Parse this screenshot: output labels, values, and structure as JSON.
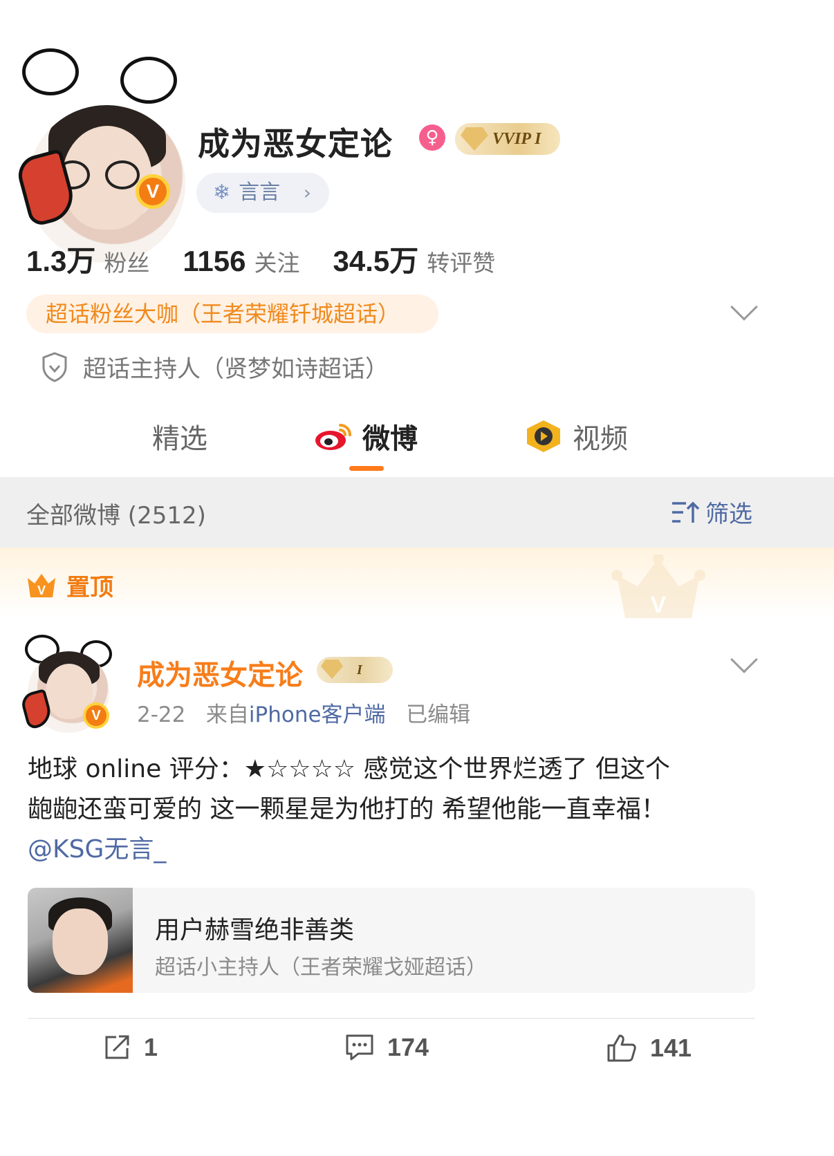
{
  "profile": {
    "nickname": "成为恶女定论",
    "vip_label": "VVIP I",
    "tag_label": "言言",
    "tag_chevron": "›",
    "verified_glyph": "V",
    "gender_glyph": "♀",
    "stats": [
      {
        "num": "1.3万",
        "label": "粉丝"
      },
      {
        "num": "1156",
        "label": "关注"
      },
      {
        "num": "34.5万",
        "label": "转评赞"
      }
    ],
    "fan_badge": "超话粉丝大咖（王者荣耀钎城超话）",
    "host_line": "超话主持人（贤梦如诗超话）"
  },
  "tabs": [
    {
      "label": "精选"
    },
    {
      "label": "微博"
    },
    {
      "label": "视频"
    }
  ],
  "filter": {
    "title": "全部微博 (2512)",
    "button": "筛选"
  },
  "pinned": {
    "label": "置顶"
  },
  "post": {
    "author": "成为恶女定论",
    "vip_label": "I",
    "date": "2-22",
    "source_prefix": "来自",
    "source": "iPhone客户端",
    "edited": "已编辑",
    "body_line1": "地球 online 评分：★☆☆☆☆ 感觉这个世界烂透了 但这个",
    "body_line2": "龅龅还蛮可爱的 这一颗星是为他打的 希望他能一直幸福！",
    "mention": "@KSG无言_",
    "quoted": {
      "title": "用户赫雪绝非善类",
      "subtitle": "超话小主持人（王者荣耀戈娅超话）"
    },
    "actions": {
      "repost": "1",
      "comment": "174",
      "like": "141"
    }
  },
  "colors": {
    "accent": "#ff7a1a",
    "link": "#4f6aa3",
    "fan_badge_bg": "#fff1e4",
    "fan_badge_text": "#f08a1c",
    "filter_bg": "#efefef"
  },
  "icons": [
    "verified-v-icon",
    "female-icon",
    "vvip-icon",
    "snowflake-icon",
    "chevron-down-icon",
    "shield-icon",
    "weibo-logo-icon",
    "video-icon",
    "filter-icon",
    "crown-icon",
    "repost-icon",
    "comment-icon",
    "like-icon"
  ]
}
